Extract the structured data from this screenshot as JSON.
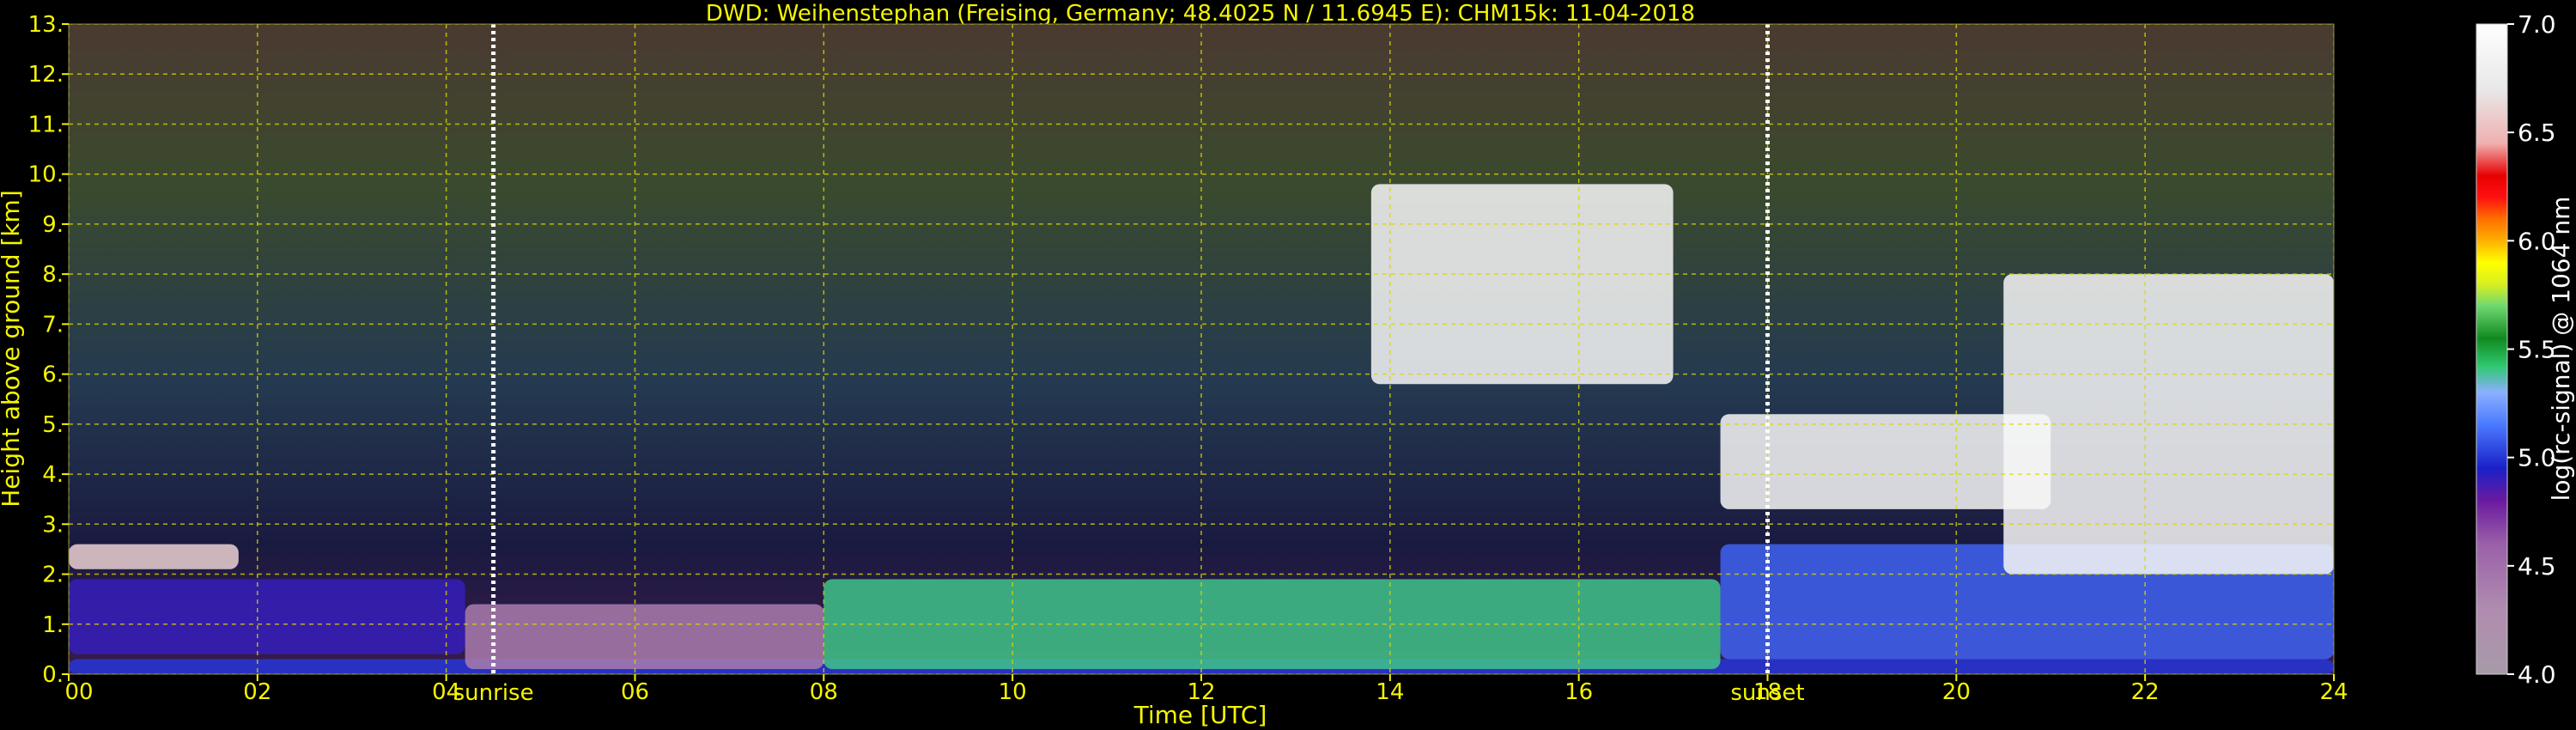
{
  "chart_data": {
    "type": "heatmap",
    "title": "DWD: Weihenstephan (Freising, Germany; 48.4025 N / 11.6945 E):    CHM15k: 11-04-2018",
    "xlabel": "Time [UTC]",
    "ylabel": "Height above ground [km]",
    "colorbar_label": "log(rc-signal) @ 1064 nm",
    "xlim": [
      0,
      24
    ],
    "ylim": [
      0,
      13
    ],
    "x_ticks": [
      {
        "value": 0,
        "label": "00"
      },
      {
        "value": 2,
        "label": "02"
      },
      {
        "value": 4,
        "label": "04"
      },
      {
        "value": 6,
        "label": "06"
      },
      {
        "value": 8,
        "label": "08"
      },
      {
        "value": 10,
        "label": "10"
      },
      {
        "value": 12,
        "label": "12"
      },
      {
        "value": 14,
        "label": "14"
      },
      {
        "value": 16,
        "label": "16"
      },
      {
        "value": 18,
        "label": "18"
      },
      {
        "value": 20,
        "label": "20"
      },
      {
        "value": 22,
        "label": "22"
      },
      {
        "value": 24,
        "label": "24"
      }
    ],
    "y_ticks": [
      {
        "value": 0,
        "label": "0."
      },
      {
        "value": 1,
        "label": "1."
      },
      {
        "value": 2,
        "label": "2."
      },
      {
        "value": 3,
        "label": "3."
      },
      {
        "value": 4,
        "label": "4."
      },
      {
        "value": 5,
        "label": "5."
      },
      {
        "value": 6,
        "label": "6."
      },
      {
        "value": 7,
        "label": "7."
      },
      {
        "value": 8,
        "label": "8."
      },
      {
        "value": 9,
        "label": "9."
      },
      {
        "value": 10,
        "label": "10."
      },
      {
        "value": 11,
        "label": "11."
      },
      {
        "value": 12,
        "label": "12."
      },
      {
        "value": 13,
        "label": "13."
      }
    ],
    "grid": true,
    "colorbar": {
      "range": [
        4.0,
        7.0
      ],
      "ticks": [
        {
          "value": 4.0,
          "label": "4.0"
        },
        {
          "value": 4.5,
          "label": "4.5"
        },
        {
          "value": 5.0,
          "label": "5.0"
        },
        {
          "value": 5.5,
          "label": "5.5"
        },
        {
          "value": 6.0,
          "label": "6.0"
        },
        {
          "value": 6.5,
          "label": "6.5"
        },
        {
          "value": 7.0,
          "label": "7.0"
        }
      ],
      "stops": [
        {
          "v": 4.0,
          "color": "#a89aa8"
        },
        {
          "v": 4.3,
          "color": "#b08cb0"
        },
        {
          "v": 4.6,
          "color": "#9a60a8"
        },
        {
          "v": 4.8,
          "color": "#6a1aa0"
        },
        {
          "v": 4.95,
          "color": "#1a20c8"
        },
        {
          "v": 5.15,
          "color": "#4a7aff"
        },
        {
          "v": 5.3,
          "color": "#8ab0ff"
        },
        {
          "v": 5.42,
          "color": "#30c870"
        },
        {
          "v": 5.55,
          "color": "#108a20"
        },
        {
          "v": 5.7,
          "color": "#70d870"
        },
        {
          "v": 5.8,
          "color": "#d8f020"
        },
        {
          "v": 5.9,
          "color": "#ffff00"
        },
        {
          "v": 6.0,
          "color": "#ffb000"
        },
        {
          "v": 6.1,
          "color": "#ff7000"
        },
        {
          "v": 6.2,
          "color": "#ff1010"
        },
        {
          "v": 6.3,
          "color": "#e80000"
        },
        {
          "v": 6.45,
          "color": "#f0b0b0"
        },
        {
          "v": 6.7,
          "color": "#e8e8e8"
        },
        {
          "v": 7.0,
          "color": "#ffffff"
        }
      ]
    },
    "annotations": [
      {
        "label": "sunrise",
        "x": 4.5
      },
      {
        "label": "sunset",
        "x": 18.0
      }
    ],
    "features": [
      {
        "name": "surface layer",
        "x_range": [
          0,
          24
        ],
        "height_range": [
          0,
          0.3
        ],
        "level": 5.0
      },
      {
        "name": "morning cloud deck",
        "x_range": [
          0,
          1.8
        ],
        "height_range": [
          2.1,
          2.6
        ],
        "level": 6.6
      },
      {
        "name": "morning aerosol layer",
        "x_range": [
          0,
          4.2
        ],
        "height_range": [
          0.4,
          1.9
        ],
        "level": 4.9
      },
      {
        "name": "pink residual layer",
        "x_range": [
          4.2,
          8.0
        ],
        "height_range": [
          0.1,
          1.4
        ],
        "level": 4.4
      },
      {
        "name": "daytime mixed layer",
        "x_range": [
          8.0,
          17.5
        ],
        "height_range": [
          0.1,
          1.9
        ],
        "level": 5.4
      },
      {
        "name": "evening boundary layer",
        "x_range": [
          17.5,
          24
        ],
        "height_range": [
          0.3,
          2.6
        ],
        "level": 5.1
      },
      {
        "name": "cirrus",
        "x_range": [
          13.8,
          17.0
        ],
        "height_range": [
          5.8,
          9.8
        ],
        "level": 6.9
      },
      {
        "name": "evening cloud band",
        "x_range": [
          17.5,
          21.0
        ],
        "height_range": [
          3.3,
          5.2
        ],
        "level": 6.9
      },
      {
        "name": "high cloud ascending",
        "x_range": [
          20.5,
          24.0
        ],
        "height_range": [
          2.0,
          8.0
        ],
        "level": 6.9
      }
    ]
  }
}
